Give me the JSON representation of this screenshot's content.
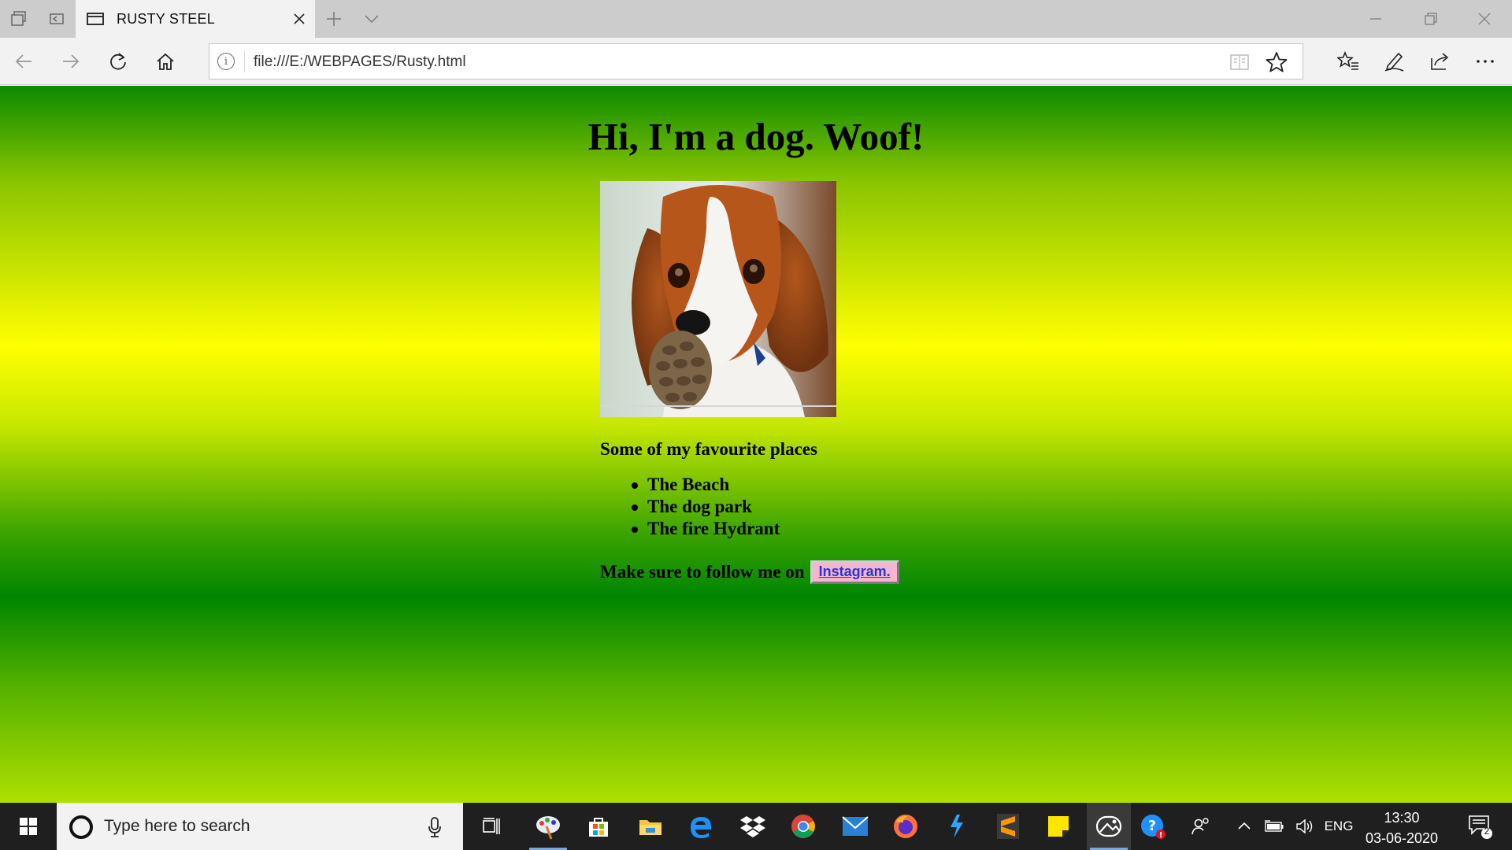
{
  "browser": {
    "tab_title": "RUSTY STEEL",
    "url": "file:///E:/WEBPAGES/Rusty.html"
  },
  "page": {
    "heading": "Hi, I'm a dog. Woof!",
    "image_alt": "dog-photo",
    "places_title": "Some of my favourite places",
    "places": [
      "The Beach",
      "The dog park",
      "The fire Hydrant"
    ],
    "follow_text": "Make sure to follow me on",
    "instagram_label": "Instagram."
  },
  "taskbar": {
    "search_placeholder": "Type here to search",
    "language": "ENG",
    "time": "13:30",
    "date": "03-06-2020",
    "notification_count": "2"
  },
  "colors": {
    "page_gradient": [
      "#0b8a00",
      "#ffff00",
      "#008500",
      "#aee000"
    ],
    "instagram_bg": "#f3b5cf",
    "instagram_text": "#2a36c8"
  }
}
